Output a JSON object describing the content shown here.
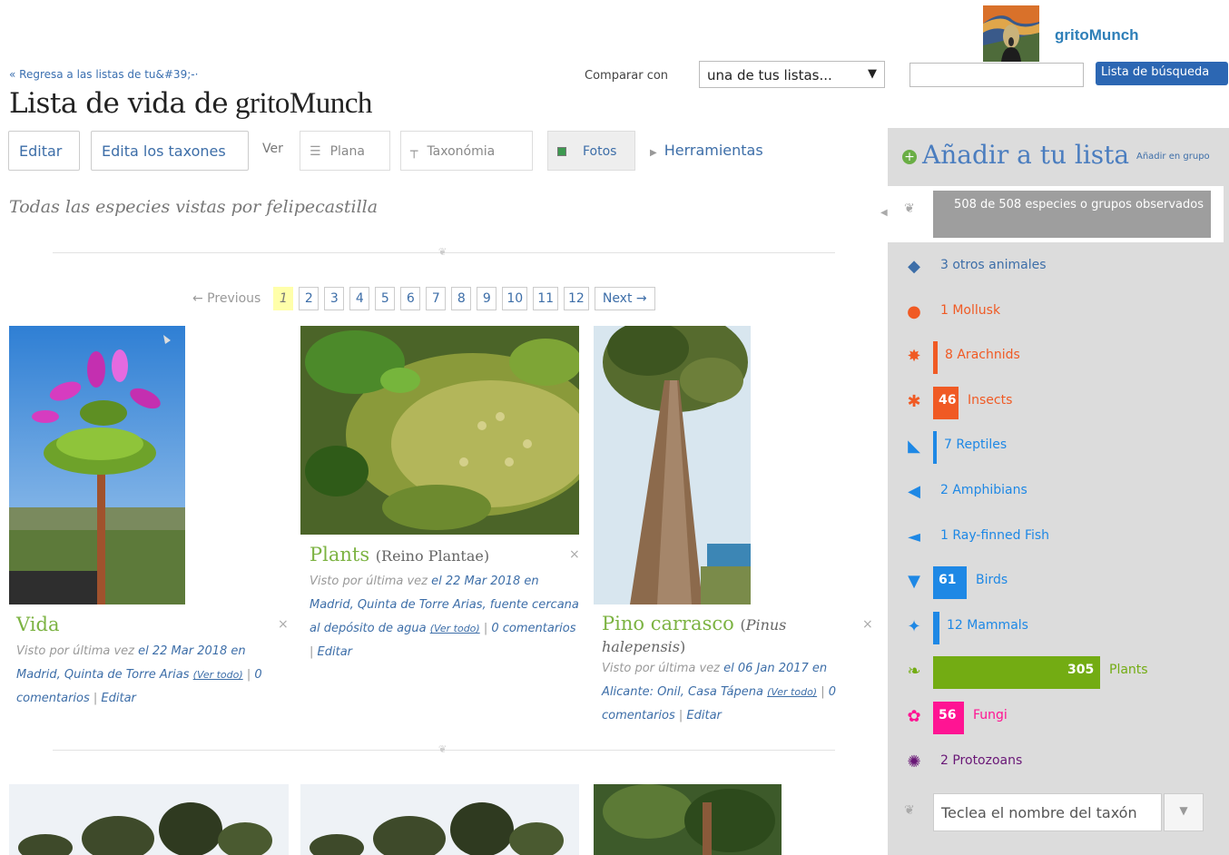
{
  "user": {
    "name": "gritoMunch"
  },
  "nav": {
    "back_link": "« Regresa a las listas de tu&#39;-·"
  },
  "compare": {
    "label": "Comparar con",
    "selected": "una de tus listas...",
    "arrow": "▼"
  },
  "search": {
    "placeholder": "",
    "button": "Lista de búsqueda"
  },
  "title": {
    "prefix": "Lista de vida de",
    "owner": "gritoMunch"
  },
  "toolbar": {
    "edit": "Editar",
    "edit_taxa": "Edita los taxones",
    "view_label": "Ver",
    "tabs": [
      {
        "label": "Plana"
      },
      {
        "label": "Taxonómia"
      },
      {
        "label": "Fotos"
      }
    ],
    "tools": "Herramientas"
  },
  "subtitle": "Todas las especies vistas por felipecastilla",
  "pagination": {
    "previous": "← Previous",
    "pages": [
      "1",
      "2",
      "3",
      "4",
      "5",
      "6",
      "7",
      "8",
      "9",
      "10",
      "11",
      "12"
    ],
    "current": "1",
    "next": "Next →"
  },
  "cards": [
    {
      "name": "Vida",
      "sci": "",
      "meta_prefix": "Visto por última vez",
      "meta_date": "el 22 Mar 2018 en",
      "meta_place": "Madrid, Quinta de Torre Arias",
      "view_all": "(Ver todo)",
      "comments": "0 comentarios",
      "edit": "Editar"
    },
    {
      "name": "Plants",
      "sci": "(Reino Plantae)",
      "meta_prefix": "Visto por última vez",
      "meta_date": "el 22 Mar 2018 en",
      "meta_place": "Madrid, Quinta de Torre Arias, fuente cercana al depósito de agua",
      "view_all": "(Ver todo)",
      "comments": "0 comentarios",
      "edit": "Editar"
    },
    {
      "name": "Pino carrasco",
      "sci_prefix": "(",
      "sci": "Pinus halepensis",
      "sci_suffix": ")",
      "meta_prefix": "Visto por última vez",
      "meta_date": "el 06 Jan 2017 en",
      "meta_place": "Alicante: Onil, Casa Tápena",
      "view_all": "(Ver todo)",
      "comments": "0 comentarios",
      "edit": "Editar"
    }
  ],
  "sidebar": {
    "add_title": "Añadir a tu lista",
    "add_group": "Añadir en grupo",
    "summary": "508 de 508 especies o grupos observados",
    "taxon_placeholder": "Teclea el nombre del taxón",
    "groups": [
      {
        "count": "3",
        "label": "otros animales",
        "color": "#3d6ea8",
        "icon": "other-animals-icon",
        "glyph": "◆",
        "fraction": 0.0
      },
      {
        "count": "1",
        "label": "Mollusk",
        "color": "#f05a24",
        "icon": "mollusk-icon",
        "glyph": "●",
        "fraction": 0.0
      },
      {
        "count": "8",
        "label": "Arachnids",
        "color": "#f05a24",
        "icon": "arachnid-icon",
        "glyph": "✸",
        "fraction": 0.026
      },
      {
        "count": "46",
        "label": "Insects",
        "color": "#f05a24",
        "icon": "insect-icon",
        "glyph": "✱",
        "fraction": 0.151
      },
      {
        "count": "7",
        "label": "Reptiles",
        "color": "#1e88e5",
        "icon": "reptile-icon",
        "glyph": "◣",
        "fraction": 0.023
      },
      {
        "count": "2",
        "label": "Amphibians",
        "color": "#1e88e5",
        "icon": "amphibian-icon",
        "glyph": "◀",
        "fraction": 0.0
      },
      {
        "count": "1",
        "label": "Ray-finned Fish",
        "color": "#1e88e5",
        "icon": "fish-icon",
        "glyph": "◄",
        "fraction": 0.0
      },
      {
        "count": "61",
        "label": "Birds",
        "color": "#1e88e5",
        "icon": "bird-icon",
        "glyph": "▼",
        "fraction": 0.2
      },
      {
        "count": "12",
        "label": "Mammals",
        "color": "#1e88e5",
        "icon": "mammal-icon",
        "glyph": "✦",
        "fraction": 0.039
      },
      {
        "count": "305",
        "label": "Plants",
        "color": "#73ac13",
        "icon": "plant-icon",
        "glyph": "❧",
        "fraction": 1.0
      },
      {
        "count": "56",
        "label": "Fungi",
        "color": "#ff1493",
        "icon": "fungi-icon",
        "glyph": "✿",
        "fraction": 0.184
      },
      {
        "count": "2",
        "label": "Protozoans",
        "color": "#691776",
        "icon": "protozoan-icon",
        "glyph": "✺",
        "fraction": 0.0
      }
    ]
  }
}
